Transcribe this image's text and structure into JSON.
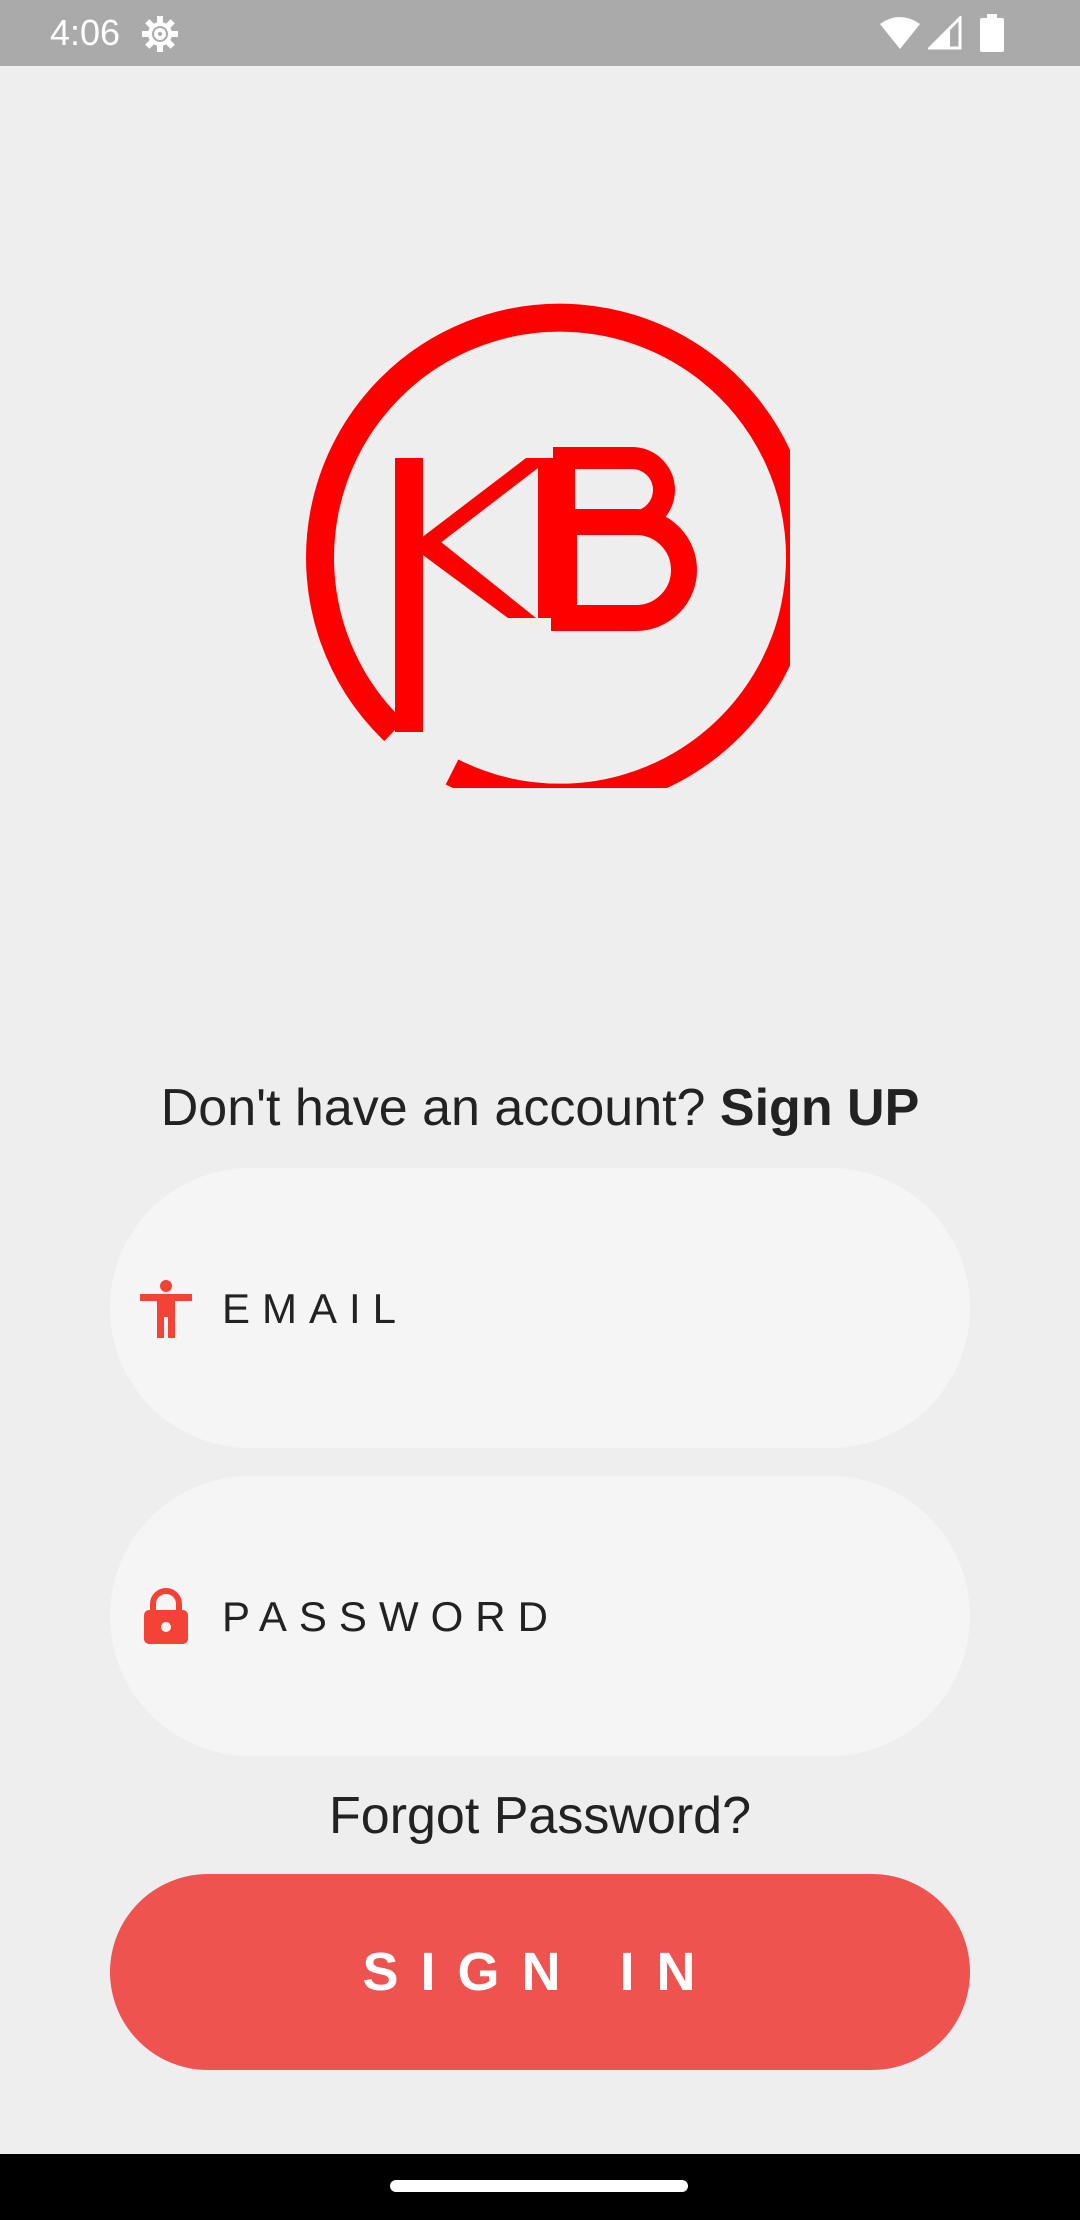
{
  "status_bar": {
    "time": "4:06",
    "icons": [
      "settings-gear-icon",
      "wifi-icon",
      "cell-signal-icon",
      "battery-icon"
    ]
  },
  "logo": {
    "text": "KB",
    "color": "#ff0000"
  },
  "signup": {
    "prompt": "Don't have an account? ",
    "link_label": "Sign UP"
  },
  "email_field": {
    "placeholder": "EMAIL",
    "value": "",
    "icon": "accessibility-person-icon"
  },
  "password_field": {
    "placeholder": "PASSWORD",
    "value": "",
    "icon": "lock-icon"
  },
  "forgot_password": "Forgot Password?",
  "sign_in_button": "SIGN IN",
  "colors": {
    "accent": "#ef5350",
    "icon_red": "#f44336",
    "background": "#eeeeee",
    "field_background": "#f5f5f5"
  }
}
